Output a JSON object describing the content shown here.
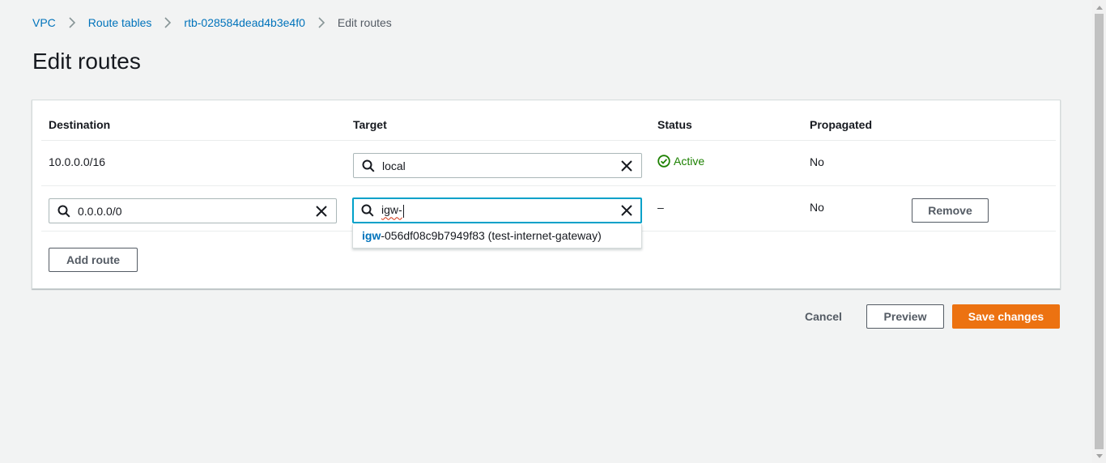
{
  "breadcrumb": {
    "items": [
      "VPC",
      "Route tables",
      "rtb-028584dead4b3e4f0"
    ],
    "current": "Edit routes"
  },
  "page": {
    "title": "Edit routes"
  },
  "table": {
    "headers": {
      "destination": "Destination",
      "target": "Target",
      "status": "Status",
      "propagated": "Propagated"
    },
    "rows": [
      {
        "destination": "10.0.0.0/16",
        "target": "local",
        "status": "Active",
        "propagated": "No"
      },
      {
        "destination": "0.0.0.0/0",
        "target": "igw-",
        "status": "–",
        "propagated": "No",
        "remove_label": "Remove"
      }
    ],
    "add_route_label": "Add route"
  },
  "dropdown": {
    "option": {
      "match": "igw",
      "rest": "-056df08c9b7949f83 (test-internet-gateway)"
    }
  },
  "footer": {
    "cancel_label": "Cancel",
    "preview_label": "Preview",
    "save_label": "Save changes"
  },
  "colors": {
    "link": "#0073bb",
    "primary": "#ec7211",
    "success": "#1d8102",
    "focus": "#00a1c9",
    "background": "#f2f3f3"
  },
  "icons": {
    "search": "search-icon",
    "clear": "close-icon",
    "status": "check-circle-icon",
    "separator": "chevron-right-icon"
  }
}
